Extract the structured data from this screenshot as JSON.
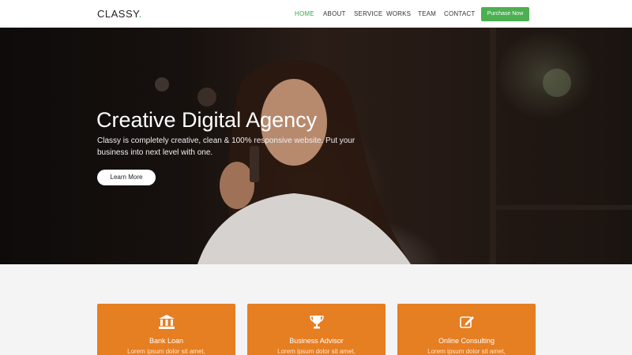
{
  "header": {
    "logo": "CLASSY",
    "logo_dot": ".",
    "nav": [
      "HOME",
      "ABOUT",
      "SERVICE",
      "WORKS",
      "TEAM",
      "CONTACT"
    ],
    "active_nav": "HOME",
    "purchase_label": "Purchase Now"
  },
  "hero": {
    "title": "Creative Digital Agency",
    "text": "Classy is completely creative, clean & 100% responsive website. Put your business into next level with one.",
    "button_label": "Learn More"
  },
  "features": [
    {
      "title": "Bank Loan",
      "text": "Lorem ipsum dolor sit amet,",
      "icon": "bank-icon"
    },
    {
      "title": "Business Advisor",
      "text": "Lorem ipsum dolor sit amet,",
      "icon": "trophy-icon"
    },
    {
      "title": "Online Consulting",
      "text": "Lorem ipsum dolor sit amet,",
      "icon": "edit-icon"
    }
  ],
  "colors": {
    "accent_green": "#4caf50",
    "card_orange": "#e67e22"
  }
}
